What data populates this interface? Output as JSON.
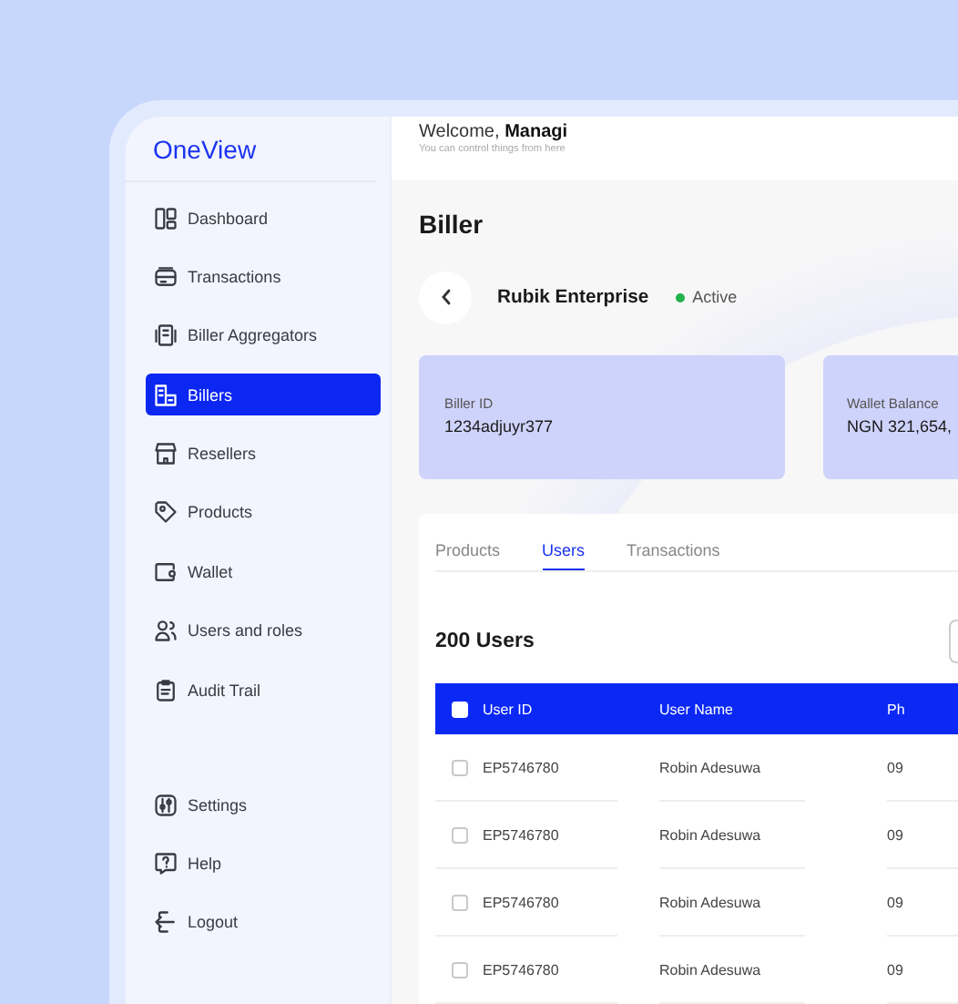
{
  "sidebar": {
    "logo": "OneView",
    "items": [
      {
        "label": "Dashboard",
        "selected": false
      },
      {
        "label": "Transactions",
        "selected": false
      },
      {
        "label": "Biller Aggregators",
        "selected": false
      },
      {
        "label": "Billers",
        "selected": true
      },
      {
        "label": "Resellers",
        "selected": false
      },
      {
        "label": "Products",
        "selected": false
      },
      {
        "label": "Wallet",
        "selected": false
      },
      {
        "label": "Users and roles",
        "selected": false
      },
      {
        "label": "Audit Trail",
        "selected": false
      }
    ],
    "bottom_items": [
      {
        "label": "Settings",
        "selected": false
      },
      {
        "label": "Help",
        "selected": false
      },
      {
        "label": "Logout",
        "selected": false
      }
    ]
  },
  "header": {
    "greeting": "Welcome, **Managi**",
    "subtitle": "You can control things from here"
  },
  "page_title": "Biller",
  "biller": {
    "name": "Rubik Enterprise",
    "status": "Active"
  },
  "cards": [
    {
      "label": "Biller ID",
      "value": "1234adjuyr377"
    },
    {
      "label": "Wallet Balance",
      "value": "NGN 321,654,"
    }
  ],
  "tabs": [
    {
      "label": "Products",
      "selected": false
    },
    {
      "label": "Users",
      "selected": true
    },
    {
      "label": "Transactions",
      "selected": false
    }
  ],
  "table": {
    "title": "200 Users",
    "header_checked": false,
    "columns": [
      "User ID",
      "User Name",
      "Ph"
    ],
    "rows": [
      {
        "checked": false,
        "cells": [
          "EP5746780",
          "Robin Adesuwa",
          "09"
        ]
      },
      {
        "checked": false,
        "cells": [
          "EP5746780",
          "Robin Adesuwa",
          "09"
        ]
      },
      {
        "checked": false,
        "cells": [
          "EP5746780",
          "Robin Adesuwa",
          "09"
        ]
      },
      {
        "checked": false,
        "cells": [
          "EP5746780",
          "Robin Adesuwa",
          "09"
        ]
      }
    ]
  }
}
